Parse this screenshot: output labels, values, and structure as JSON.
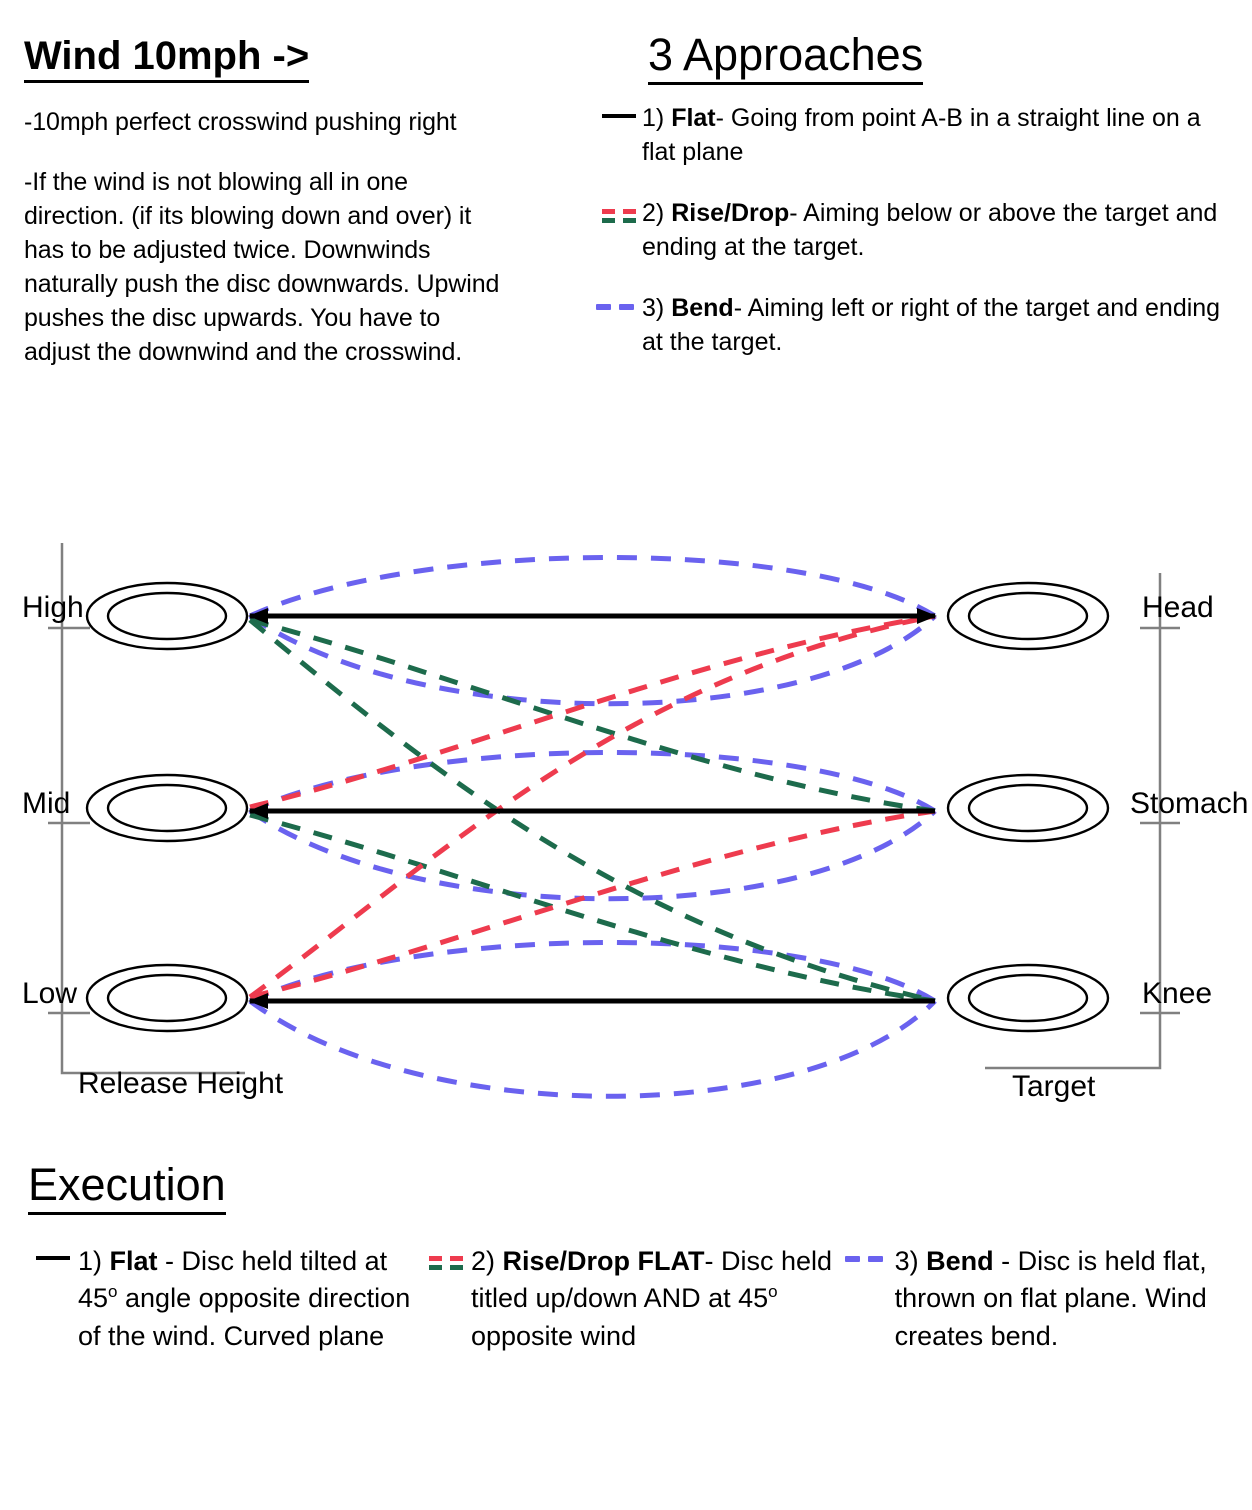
{
  "wind": {
    "title": "Wind 10mph ->",
    "para1": "-10mph perfect crosswind pushing right",
    "para2": "-If the wind is not blowing all in one direction.  (if its blowing down and over) it has to be adjusted twice.  Downwinds naturally push the disc downwards.  Upwind pushes the disc upwards.  You have to adjust the downwind and the crosswind."
  },
  "approaches": {
    "title": "3 Approaches",
    "items": [
      {
        "num": "1)",
        "name": "Flat",
        "desc": "- Going from point A-B in a straight line on a flat plane",
        "swatch": "solid-black-line"
      },
      {
        "num": "2)",
        "name": "Rise/Drop",
        "desc": "- Aiming below or above the target and ending at the target.",
        "swatch": "dashed-red-green-lines"
      },
      {
        "num": "3)",
        "name": "Bend",
        "desc": "- Aiming left or right of the target and ending at the target.",
        "swatch": "dashed-blue-line"
      }
    ]
  },
  "execution": {
    "title": "Execution",
    "items": [
      {
        "num": "1)",
        "name": "Flat",
        "desc_a": " - Disc held tilted at 45",
        "deg": "o",
        "desc_b": " angle  opposite direction of the wind. Curved plane",
        "swatch": "solid-black-line"
      },
      {
        "num": "2)",
        "name": "Rise/Drop FLAT",
        "desc_a": "- Disc held titled up/down AND at 45",
        "deg": "o",
        "desc_b": " opposite wind",
        "swatch": "dashed-red-green-lines"
      },
      {
        "num": "3)",
        "name": "Bend",
        "desc_a": " - Disc is held flat, thrown on flat plane. Wind creates bend.",
        "deg": "",
        "desc_b": "",
        "swatch": "dashed-blue-line"
      }
    ]
  },
  "diagram": {
    "left_axis_caption": "Release Height",
    "right_axis_caption": "Target",
    "left_labels": [
      "High",
      "Mid",
      "Low"
    ],
    "right_labels": [
      "Head",
      "Stomach",
      "Knee"
    ],
    "colors": {
      "flat": "#000000",
      "rise": "#ee3b4e",
      "drop": "#1d6b4c",
      "bend": "#6a62ef",
      "axis": "#808080"
    }
  },
  "chart_data": {
    "type": "line",
    "title": "Release Height to Target trajectory chart",
    "xlabel": "Release Height",
    "ylabel": "Target",
    "x": [
      "release",
      "target"
    ],
    "categories": [
      "High / Head",
      "Mid / Stomach",
      "Low / Knee"
    ],
    "release_levels": [
      {
        "label": "High",
        "y": 80
      },
      {
        "label": "Mid",
        "y": 275
      },
      {
        "label": "Low",
        "y": 465
      }
    ],
    "target_levels": [
      {
        "label": "Head",
        "y": 80
      },
      {
        "label": "Stomach",
        "y": 275
      },
      {
        "label": "Knee",
        "y": 465
      }
    ],
    "series": [
      {
        "name": "Flat",
        "color": "#000000",
        "style": "solid",
        "paths": [
          {
            "from": "High",
            "to": "Head"
          },
          {
            "from": "Mid",
            "to": "Stomach"
          },
          {
            "from": "Low",
            "to": "Knee"
          }
        ]
      },
      {
        "name": "Rise",
        "color": "#ee3b4e",
        "style": "dashed",
        "paths": [
          {
            "from": "Mid",
            "to": "Head"
          },
          {
            "from": "Low",
            "to": "Head"
          },
          {
            "from": "Low",
            "to": "Stomach"
          }
        ]
      },
      {
        "name": "Drop",
        "color": "#1d6b4c",
        "style": "dashed",
        "paths": [
          {
            "from": "High",
            "to": "Stomach"
          },
          {
            "from": "High",
            "to": "Knee"
          },
          {
            "from": "Mid",
            "to": "Knee"
          }
        ]
      },
      {
        "name": "Bend",
        "color": "#6a62ef",
        "style": "dashed",
        "paths": [
          {
            "from": "High",
            "to": "Head",
            "bow": "up"
          },
          {
            "from": "High",
            "to": "Head",
            "bow": "down"
          },
          {
            "from": "Mid",
            "to": "Stomach",
            "bow": "up"
          },
          {
            "from": "Mid",
            "to": "Stomach",
            "bow": "down"
          },
          {
            "from": "Low",
            "to": "Knee",
            "bow": "up"
          },
          {
            "from": "Low",
            "to": "Knee",
            "bow": "down"
          }
        ]
      }
    ],
    "grid": false,
    "legend": "external"
  }
}
